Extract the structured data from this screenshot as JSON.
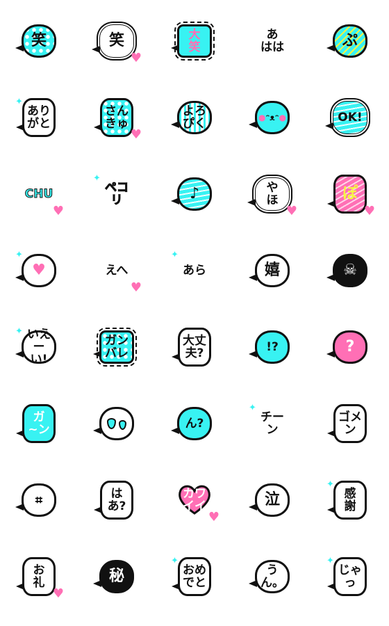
{
  "colors": {
    "cyan": "#38f2f2",
    "pink": "#ff6fb5",
    "black": "#111111",
    "white": "#ffffff",
    "yellow": "#f5f542"
  },
  "stickers": [
    {
      "text": "笑",
      "shape": "bubble",
      "fill": "#38f2f2",
      "pattern": "dots",
      "color": "#111111"
    },
    {
      "text": "笑",
      "shape": "cloud",
      "fill": "#ffffff",
      "pattern": "",
      "color": "#111111",
      "deco": "heart-icon"
    },
    {
      "text": "大\n笑",
      "shape": "burst",
      "fill": "#38f2f2",
      "pattern": "",
      "color": "#ff6fb5"
    },
    {
      "text": "あ\nはは",
      "shape": "none",
      "fill": "#ffffff",
      "pattern": "",
      "color": "#111111"
    },
    {
      "text": "ぷ",
      "shape": "bubble",
      "fill": "#38f2f2",
      "pattern": "ystripes",
      "color": "#111111"
    },
    {
      "text": "あり\nがと",
      "shape": "square",
      "fill": "#ffffff",
      "pattern": "",
      "color": "#111111",
      "deco": "sparkle-icon"
    },
    {
      "text": "さん\nきゅ",
      "shape": "square",
      "fill": "#38f2f2",
      "pattern": "dots",
      "color": "#111111",
      "deco": "heart-icon"
    },
    {
      "text": "よろ\nぴく",
      "shape": "bubble",
      "fill": "#ffffff",
      "pattern": "vstripes",
      "color": "#111111"
    },
    {
      "text": "",
      "icon": "smiling-face-icon",
      "shape": "bubble",
      "fill": "#38f2f2",
      "pattern": "",
      "color": "#111111"
    },
    {
      "text": "OK!",
      "shape": "cloud",
      "fill": "#38f2f2",
      "pattern": "hstripes",
      "color": "#111111"
    },
    {
      "text": "CHU",
      "shape": "none",
      "fill": "#ffffff",
      "pattern": "",
      "color": "#38f2f2",
      "deco": "heart-icon"
    },
    {
      "text": "ペコリ",
      "shape": "none",
      "fill": "#ffffff",
      "pattern": "",
      "color": "#38f2f2",
      "deco": "sparkle-icon"
    },
    {
      "text": "♪",
      "icon": "music-note-icon",
      "shape": "bubble",
      "fill": "#38f2f2",
      "pattern": "hstripes",
      "color": "#111111"
    },
    {
      "text": "や\nほ",
      "shape": "cloud",
      "fill": "#ffffff",
      "pattern": "",
      "color": "#111111",
      "deco": "heart-icon"
    },
    {
      "text": "ぽ",
      "shape": "square",
      "fill": "#ff6fb5",
      "pattern": "pstripes",
      "color": "#f5f542",
      "deco": "heart-icon"
    },
    {
      "text": "♥",
      "icon": "heart-icon",
      "shape": "bubble",
      "fill": "#ffffff",
      "pattern": "",
      "color": "#ff6fb5",
      "deco": "sparkle-icon"
    },
    {
      "text": "えへ",
      "shape": "none",
      "fill": "#ffffff",
      "pattern": "",
      "color": "#111111",
      "deco": "heart-icon"
    },
    {
      "text": "あら",
      "shape": "none",
      "fill": "#ffffff",
      "pattern": "",
      "color": "#111111",
      "deco": "sparkle-icon"
    },
    {
      "text": "嬉",
      "shape": "bubble",
      "fill": "#ffffff",
      "pattern": "",
      "color": "#111111"
    },
    {
      "text": "☠",
      "icon": "skull-icon",
      "shape": "bubble",
      "fill": "#111111",
      "pattern": "",
      "color": "#ffffff"
    },
    {
      "text": "いえー\nい!",
      "shape": "bubble",
      "fill": "#ffffff",
      "pattern": "",
      "color": "#111111",
      "deco": "sparkle-icon"
    },
    {
      "text": "ガン\nバレ",
      "shape": "burst",
      "fill": "#38f2f2",
      "pattern": "dots",
      "color": "#111111"
    },
    {
      "text": "大丈\n夫?",
      "shape": "square",
      "fill": "#ffffff",
      "pattern": "",
      "color": "#111111"
    },
    {
      "text": "!?",
      "shape": "bubble",
      "fill": "#38f2f2",
      "pattern": "",
      "color": "#111111"
    },
    {
      "text": "?",
      "shape": "bubble",
      "fill": "#ff6fb5",
      "pattern": "",
      "color": "#ffffff"
    },
    {
      "text": "ガ\n~ン",
      "shape": "square",
      "fill": "#38f2f2",
      "pattern": "",
      "color": "#ffffff"
    },
    {
      "text": "",
      "icon": "water-drops-icon",
      "shape": "bubble",
      "fill": "#ffffff",
      "pattern": "",
      "color": "#38f2f2"
    },
    {
      "text": "ん?",
      "shape": "bubble",
      "fill": "#38f2f2",
      "pattern": "",
      "color": "#111111"
    },
    {
      "text": "チーン",
      "shape": "none",
      "fill": "#ffffff",
      "pattern": "",
      "color": "#111111",
      "deco": "sparkle-icon"
    },
    {
      "text": "ゴメ\nン",
      "shape": "square",
      "fill": "#ffffff",
      "pattern": "",
      "color": "#111111"
    },
    {
      "text": "",
      "icon": "anger-mark-icon",
      "shape": "bubble",
      "fill": "#ffffff",
      "pattern": "",
      "color": "#111111"
    },
    {
      "text": "は\nあ?",
      "shape": "square",
      "fill": "#ffffff",
      "pattern": "",
      "color": "#111111"
    },
    {
      "text": "カワ\nイイ",
      "shape": "heart",
      "fill": "#ff6fb5",
      "pattern": "",
      "color": "#ffffff",
      "deco": "heart-icon"
    },
    {
      "text": "泣",
      "shape": "bubble",
      "fill": "#ffffff",
      "pattern": "",
      "color": "#111111"
    },
    {
      "text": "感\n謝",
      "shape": "square",
      "fill": "#ffffff",
      "pattern": "",
      "color": "#111111",
      "deco": "sparkle-icon"
    },
    {
      "text": "お\n礼",
      "shape": "square",
      "fill": "#ffffff",
      "pattern": "",
      "color": "#111111",
      "deco": "heart-icon"
    },
    {
      "text": "秘",
      "shape": "bubble",
      "fill": "#111111",
      "pattern": "",
      "color": "#ffffff"
    },
    {
      "text": "おめ\nでと",
      "shape": "square",
      "fill": "#ffffff",
      "pattern": "",
      "color": "#111111",
      "deco": "sparkle-icon"
    },
    {
      "text": "うん。",
      "shape": "bubble",
      "fill": "#ffffff",
      "pattern": "",
      "color": "#111111"
    },
    {
      "text": "じゃっ",
      "shape": "square",
      "fill": "#ffffff",
      "pattern": "",
      "color": "#111111",
      "deco": "sparkle-icon"
    }
  ]
}
